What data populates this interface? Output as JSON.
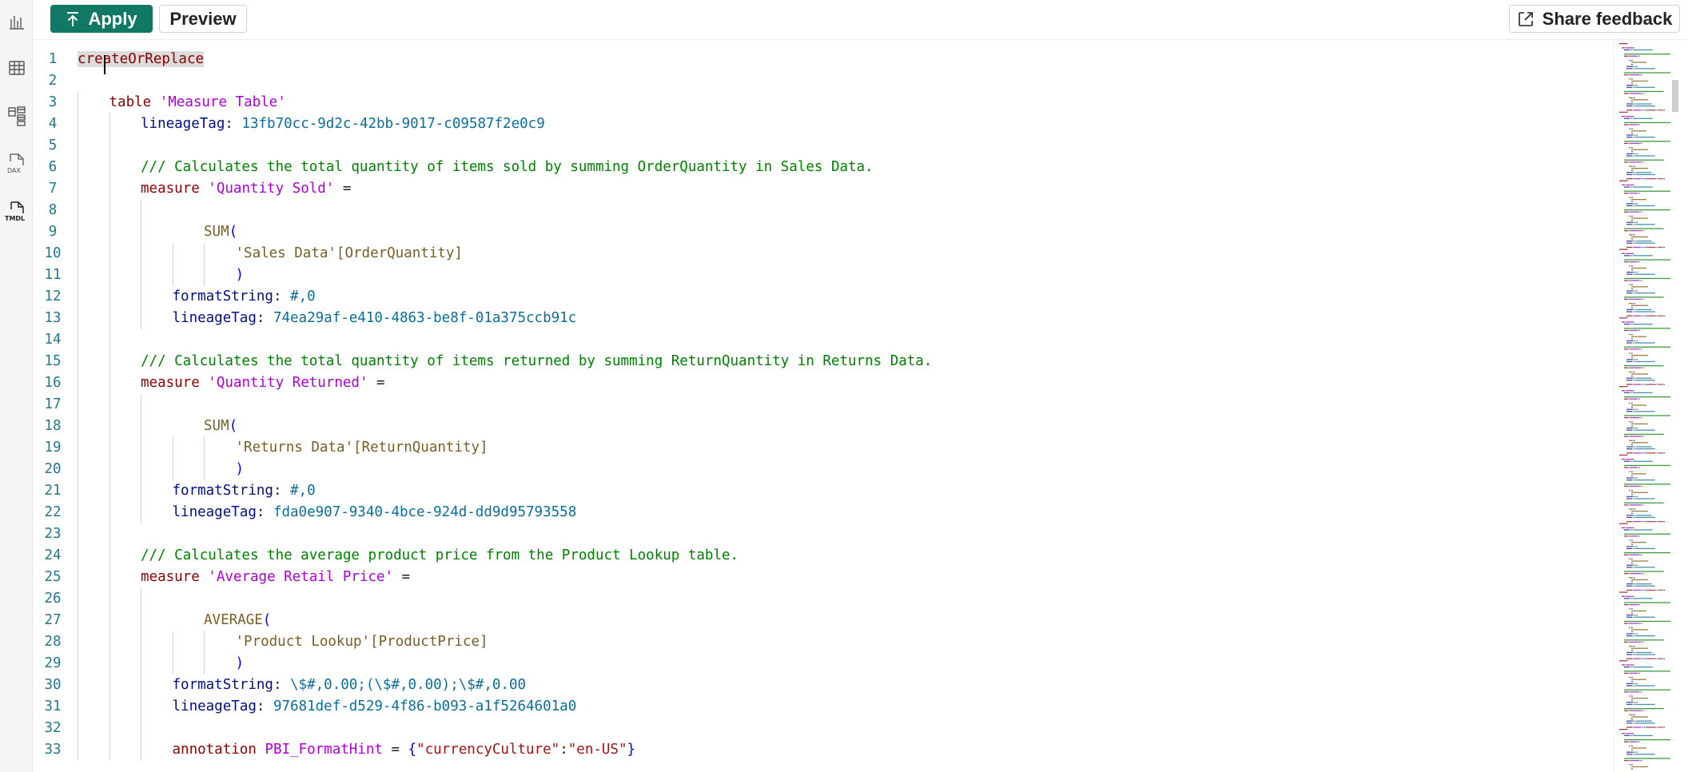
{
  "toolbar": {
    "apply_label": "Apply",
    "preview_label": "Preview",
    "feedback_label": "Share feedback"
  },
  "rail": {
    "items": [
      {
        "name": "report-view",
        "icon": "bar-chart-icon"
      },
      {
        "name": "table-view",
        "icon": "table-grid-icon"
      },
      {
        "name": "model-view",
        "icon": "model-diagram-icon"
      },
      {
        "name": "dax-query-view",
        "icon": "dax-icon",
        "label": "DAX"
      },
      {
        "name": "tmdl-view",
        "icon": "tmdl-icon",
        "label": "TMDL"
      }
    ]
  },
  "editor": {
    "lines": [
      {
        "n": "1",
        "indent": 0,
        "tokens": [
          [
            "k-kw",
            "createOrReplace"
          ]
        ]
      },
      {
        "n": "2",
        "indent": 0,
        "tokens": []
      },
      {
        "n": "3",
        "indent": 1,
        "tokens": [
          [
            "k-kw",
            "table "
          ],
          [
            "k-name",
            "'Measure Table'"
          ]
        ]
      },
      {
        "n": "4",
        "indent": 2,
        "tokens": [
          [
            "k-prop",
            "lineageTag"
          ],
          [
            "k-txt",
            ": "
          ],
          [
            "k-val",
            "13fb70cc-9d2c-42bb-9017-c09587f2e0c9"
          ]
        ]
      },
      {
        "n": "5",
        "indent": 0,
        "tokens": []
      },
      {
        "n": "6",
        "indent": 2,
        "tokens": [
          [
            "k-com",
            "/// Calculates the total quantity of items sold by summing OrderQuantity in Sales Data."
          ]
        ]
      },
      {
        "n": "7",
        "indent": 2,
        "tokens": [
          [
            "k-kw",
            "measure "
          ],
          [
            "k-name",
            "'Quantity Sold'"
          ],
          [
            "k-txt",
            " ="
          ]
        ]
      },
      {
        "n": "8",
        "indent": 0,
        "tokens": []
      },
      {
        "n": "9",
        "indent": 4,
        "tokens": [
          [
            "k-fn",
            "SUM"
          ],
          [
            "k-pun",
            "("
          ]
        ]
      },
      {
        "n": "10",
        "indent": 5,
        "tokens": [
          [
            "k-ref",
            "'Sales Data'[OrderQuantity]"
          ]
        ]
      },
      {
        "n": "11",
        "indent": 5,
        "tokens": [
          [
            "k-pun",
            ")"
          ]
        ]
      },
      {
        "n": "12",
        "indent": 3,
        "tokens": [
          [
            "k-prop",
            "formatString"
          ],
          [
            "k-txt",
            ": "
          ],
          [
            "k-val",
            "#,0"
          ]
        ]
      },
      {
        "n": "13",
        "indent": 3,
        "tokens": [
          [
            "k-prop",
            "lineageTag"
          ],
          [
            "k-txt",
            ": "
          ],
          [
            "k-val",
            "74ea29af-e410-4863-be8f-01a375ccb91c"
          ]
        ]
      },
      {
        "n": "14",
        "indent": 0,
        "tokens": []
      },
      {
        "n": "15",
        "indent": 2,
        "tokens": [
          [
            "k-com",
            "/// Calculates the total quantity of items returned by summing ReturnQuantity in Returns Data."
          ]
        ]
      },
      {
        "n": "16",
        "indent": 2,
        "tokens": [
          [
            "k-kw",
            "measure "
          ],
          [
            "k-name",
            "'Quantity Returned'"
          ],
          [
            "k-txt",
            " ="
          ]
        ]
      },
      {
        "n": "17",
        "indent": 0,
        "tokens": []
      },
      {
        "n": "18",
        "indent": 4,
        "tokens": [
          [
            "k-fn",
            "SUM"
          ],
          [
            "k-pun",
            "("
          ]
        ]
      },
      {
        "n": "19",
        "indent": 5,
        "tokens": [
          [
            "k-ref",
            "'Returns Data'[ReturnQuantity]"
          ]
        ]
      },
      {
        "n": "20",
        "indent": 5,
        "tokens": [
          [
            "k-pun",
            ")"
          ]
        ]
      },
      {
        "n": "21",
        "indent": 3,
        "tokens": [
          [
            "k-prop",
            "formatString"
          ],
          [
            "k-txt",
            ": "
          ],
          [
            "k-val",
            "#,0"
          ]
        ]
      },
      {
        "n": "22",
        "indent": 3,
        "tokens": [
          [
            "k-prop",
            "lineageTag"
          ],
          [
            "k-txt",
            ": "
          ],
          [
            "k-val",
            "fda0e907-9340-4bce-924d-dd9d95793558"
          ]
        ]
      },
      {
        "n": "23",
        "indent": 0,
        "tokens": []
      },
      {
        "n": "24",
        "indent": 2,
        "tokens": [
          [
            "k-com",
            "/// Calculates the average product price from the Product Lookup table."
          ]
        ]
      },
      {
        "n": "25",
        "indent": 2,
        "tokens": [
          [
            "k-kw",
            "measure "
          ],
          [
            "k-name",
            "'Average Retail Price'"
          ],
          [
            "k-txt",
            " ="
          ]
        ]
      },
      {
        "n": "26",
        "indent": 0,
        "tokens": []
      },
      {
        "n": "27",
        "indent": 4,
        "tokens": [
          [
            "k-fn",
            "AVERAGE"
          ],
          [
            "k-pun",
            "("
          ]
        ]
      },
      {
        "n": "28",
        "indent": 5,
        "tokens": [
          [
            "k-ref",
            "'Product Lookup'[ProductPrice]"
          ]
        ]
      },
      {
        "n": "29",
        "indent": 5,
        "tokens": [
          [
            "k-pun",
            ")"
          ]
        ]
      },
      {
        "n": "30",
        "indent": 3,
        "tokens": [
          [
            "k-prop",
            "formatString"
          ],
          [
            "k-txt",
            ": "
          ],
          [
            "k-val",
            "\\$#,0.00;(\\$#,0.00);\\$#,0.00"
          ]
        ]
      },
      {
        "n": "31",
        "indent": 3,
        "tokens": [
          [
            "k-prop",
            "lineageTag"
          ],
          [
            "k-txt",
            ": "
          ],
          [
            "k-val",
            "97681def-d529-4f86-b093-a1f5264601a0"
          ]
        ]
      },
      {
        "n": "32",
        "indent": 0,
        "tokens": []
      },
      {
        "n": "33",
        "indent": 3,
        "tokens": [
          [
            "k-kw",
            "annotation "
          ],
          [
            "k-name",
            "PBI_FormatHint"
          ],
          [
            "k-txt",
            " = "
          ],
          [
            "k-pun",
            "{"
          ],
          [
            "k-str",
            "\"currencyCulture\""
          ],
          [
            "k-txt",
            ":"
          ],
          [
            "k-str",
            "\"en-US\""
          ],
          [
            "k-pun",
            "}"
          ]
        ]
      }
    ]
  },
  "colors": {
    "accent": "#117865",
    "line_number": "#237893",
    "comment": "#008000",
    "keyword": "#8b0000",
    "name": "#af00db"
  }
}
